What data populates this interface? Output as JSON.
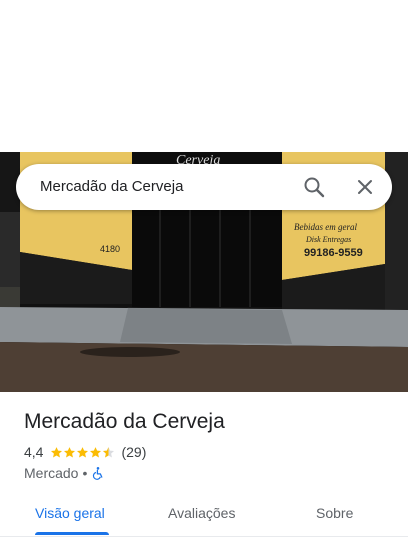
{
  "search": {
    "query": "Mercadão da Cerveja"
  },
  "photo": {
    "sign_top": "Cerveja",
    "sign_right": [
      "Bebidas em geral",
      "Disk Entregas",
      "99186-9559"
    ],
    "sign_left_number": "4180"
  },
  "place": {
    "title": "Mercadão da Cerveja",
    "rating": "4,4",
    "review_count": "(29)",
    "stars": 4.4,
    "category": "Mercado",
    "separator": "•",
    "accessibility_icon": "wheelchair-icon"
  },
  "tabs": [
    {
      "label": "Visão geral",
      "active": true
    },
    {
      "label": "Avaliações",
      "active": false
    },
    {
      "label": "Sobre",
      "active": false
    }
  ],
  "colors": {
    "accent": "#1a73e8",
    "star": "#fbbc04",
    "accessibility": "#1a73e8"
  }
}
